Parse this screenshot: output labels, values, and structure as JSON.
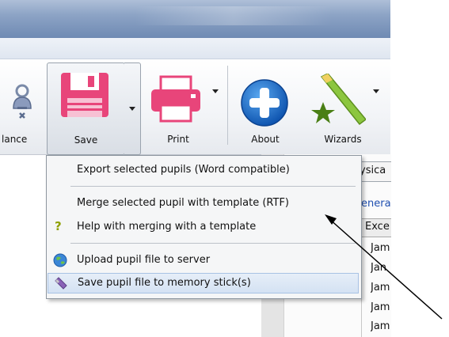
{
  "toolbar": {
    "partial_label": "lance",
    "save_label": "Save",
    "print_label": "Print",
    "about_label": "About",
    "wizards_label": "Wizards"
  },
  "save_menu": {
    "items": [
      {
        "label": "Export selected pupils (Word compatible)",
        "icon": ""
      },
      {
        "label": "Merge selected pupil with template (RTF)",
        "icon": ""
      },
      {
        "label": "Help with merging with a template",
        "icon": "question-mark-icon"
      },
      {
        "label": "Upload pupil file to server",
        "icon": "globe-icon"
      },
      {
        "label": "Save pupil file to memory stick(s)",
        "icon": "memory-stick-icon"
      }
    ],
    "highlighted_index": 4
  },
  "background_panel": {
    "tab_label": "ysica",
    "link_text": "enera",
    "column_header": "Exce",
    "rows": [
      "Jam",
      "Jan",
      "Jam",
      "Jam",
      "Jam"
    ]
  },
  "colors": {
    "save_pink": "#e8457a",
    "print_pink": "#e8457a",
    "about_blue": "#1a6fc9",
    "wizard_green": "#7ab51d",
    "menu_highlight": "#d4e2f3",
    "link_blue": "#1f4fb0"
  }
}
